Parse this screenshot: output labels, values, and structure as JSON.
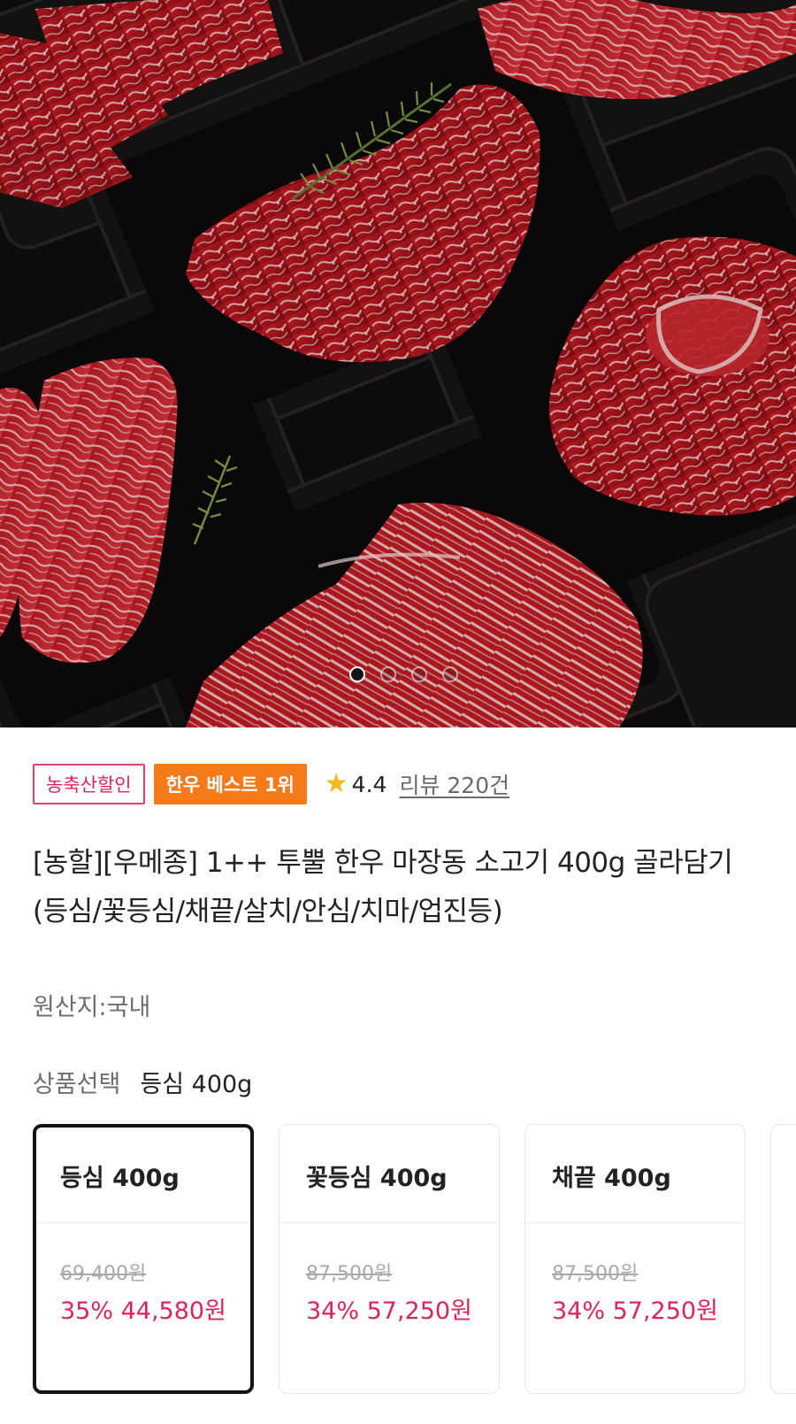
{
  "hero": {
    "image_label": "meat-trays-photo",
    "dots": 4,
    "active_dot": 1
  },
  "badges": {
    "discount_badge": "농축산할인",
    "best_badge": "한우 베스트 1위"
  },
  "rating": {
    "star": "★",
    "score": "4.4",
    "reviews": "리뷰 220건"
  },
  "product": {
    "title": "[농할][우메종] 1++ 투뿔 한우 마장동 소고기 400g 골라담기(등심/꽃등심/채끝/살치/안심/치마/업진등)",
    "origin": "원산지:국내"
  },
  "selection": {
    "label": "상품선택",
    "value": "등심 400g"
  },
  "options": [
    {
      "name": "등심 400g",
      "original_price": "69,400원",
      "sale": "35% 44,580원",
      "selected": true
    },
    {
      "name": "꽃등심 400g",
      "original_price": "87,500원",
      "sale": "34% 57,250원",
      "selected": false
    },
    {
      "name": "채끝 400g",
      "original_price": "87,500원",
      "sale": "34% 57,250원",
      "selected": false
    }
  ],
  "colors": {
    "accent_pink": "#e0225a",
    "badge_orange": "#f47a1a",
    "star_yellow": "#f7b81b"
  }
}
